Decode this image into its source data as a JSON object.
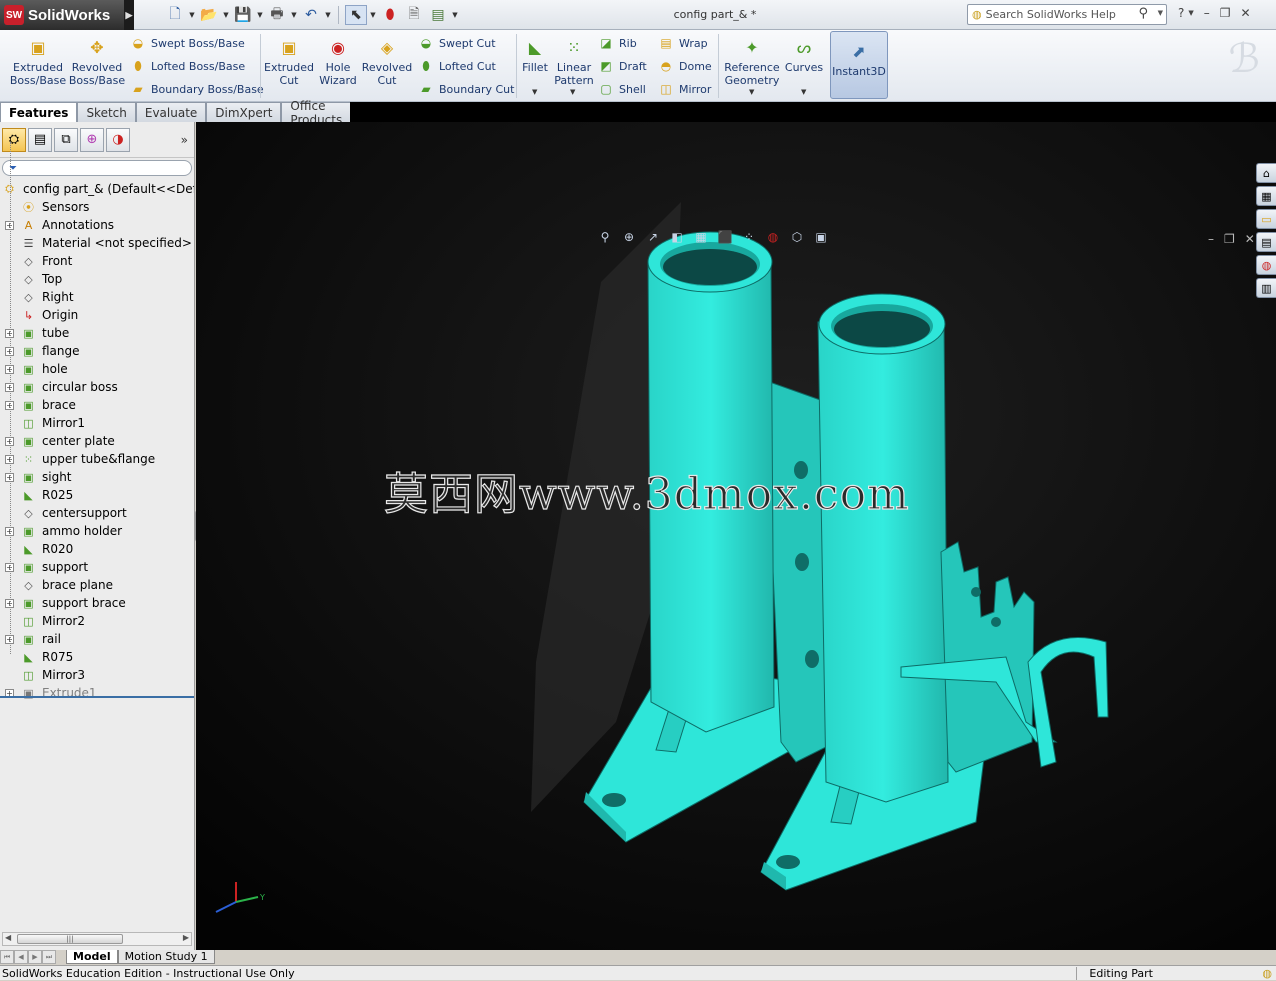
{
  "app": {
    "brand": "SolidWorks",
    "brand_icon": "SW",
    "doc_title": "config part_& *",
    "search_placeholder": "Search SolidWorks Help"
  },
  "ribbon": {
    "extruded_boss": [
      "Extruded",
      "Boss/Base"
    ],
    "revolved_boss": [
      "Revolved",
      "Boss/Base"
    ],
    "swept_boss": "Swept Boss/Base",
    "lofted_boss": "Lofted Boss/Base",
    "boundary_boss": "Boundary Boss/Base",
    "extruded_cut": [
      "Extruded",
      "Cut"
    ],
    "hole_wizard": [
      "Hole",
      "Wizard"
    ],
    "revolved_cut": [
      "Revolved",
      "Cut"
    ],
    "swept_cut": "Swept Cut",
    "lofted_cut": "Lofted Cut",
    "boundary_cut": "Boundary Cut",
    "fillet": "Fillet",
    "linear_pattern": [
      "Linear",
      "Pattern"
    ],
    "rib": "Rib",
    "draft": "Draft",
    "shell": "Shell",
    "wrap": "Wrap",
    "dome": "Dome",
    "mirror": "Mirror",
    "reference_geometry": [
      "Reference",
      "Geometry"
    ],
    "curves": "Curves",
    "instant3d": "Instant3D"
  },
  "tabs": [
    "Features",
    "Sketch",
    "Evaluate",
    "DimXpert",
    "Office Products"
  ],
  "tree": {
    "root": "config part_&  (Default<<Default>",
    "items": [
      {
        "label": "Sensors",
        "icon": "sensor-icon",
        "exp": false
      },
      {
        "label": "Annotations",
        "icon": "annotation-icon",
        "exp": true
      },
      {
        "label": "Material <not specified>",
        "icon": "material-icon",
        "exp": false
      },
      {
        "label": "Front",
        "icon": "plane-icon",
        "exp": false
      },
      {
        "label": "Top",
        "icon": "plane-icon",
        "exp": false
      },
      {
        "label": "Right",
        "icon": "plane-icon",
        "exp": false
      },
      {
        "label": "Origin",
        "icon": "origin-icon",
        "exp": false
      },
      {
        "label": "tube",
        "icon": "extrude-icon",
        "exp": true
      },
      {
        "label": "flange",
        "icon": "extrude-icon",
        "exp": true
      },
      {
        "label": "hole",
        "icon": "extrude-icon",
        "exp": true
      },
      {
        "label": "circular boss",
        "icon": "extrude-icon",
        "exp": true
      },
      {
        "label": "brace",
        "icon": "extrude-icon",
        "exp": true
      },
      {
        "label": "Mirror1",
        "icon": "mirror-icon",
        "exp": false
      },
      {
        "label": "center plate",
        "icon": "extrude-icon",
        "exp": true
      },
      {
        "label": "upper tube&flange",
        "icon": "pattern-icon",
        "exp": true
      },
      {
        "label": "sight",
        "icon": "extrude-icon",
        "exp": true
      },
      {
        "label": "R025",
        "icon": "fillet-icon",
        "exp": false
      },
      {
        "label": "centersupport",
        "icon": "plane-icon",
        "exp": false
      },
      {
        "label": "ammo holder",
        "icon": "extrude-icon",
        "exp": true
      },
      {
        "label": "R020",
        "icon": "fillet-icon",
        "exp": false
      },
      {
        "label": "support",
        "icon": "extrude-icon",
        "exp": true
      },
      {
        "label": "brace plane",
        "icon": "plane-icon",
        "exp": false
      },
      {
        "label": "support brace",
        "icon": "extrude-icon",
        "exp": true
      },
      {
        "label": "Mirror2",
        "icon": "mirror-icon",
        "exp": false
      },
      {
        "label": "rail",
        "icon": "extrude-icon",
        "exp": true
      },
      {
        "label": "R075",
        "icon": "fillet-icon",
        "exp": false
      },
      {
        "label": "Mirror3",
        "icon": "mirror-icon",
        "exp": false
      },
      {
        "label": "Extrude1",
        "icon": "extrude-suppressed-icon",
        "exp": true,
        "suppressed": true
      }
    ]
  },
  "viewport": {
    "watermark": "莫西网www.3dmox.com",
    "model_color": "#2ee6d9",
    "triad_labels": [
      "Y",
      "X",
      "Z"
    ]
  },
  "status": {
    "tabs": [
      "Model",
      "Motion Study 1"
    ],
    "message": "SolidWorks Education Edition - Instructional Use Only",
    "mode": "Editing Part"
  },
  "colors": {
    "accent": "#2a5eb2",
    "ribbon_text": "#1e3a6e",
    "model": "#2ee6d9",
    "model_shade": "#1fb8ad"
  }
}
